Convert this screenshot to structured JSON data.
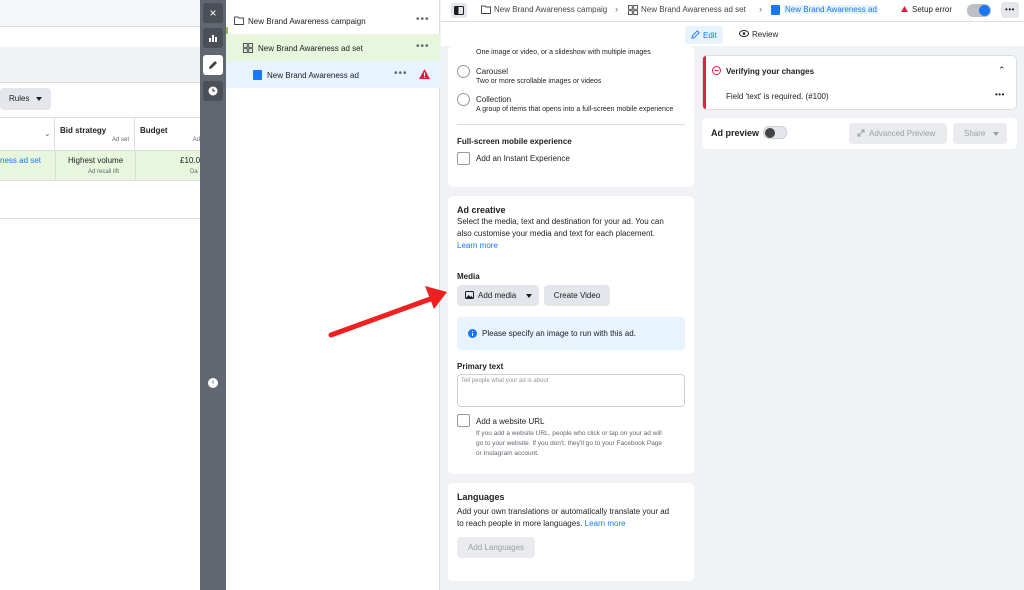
{
  "background_manager": {
    "rules_label": "Rules",
    "columns": [
      {
        "header": "",
        "sub": ""
      },
      {
        "header": "Bid strategy",
        "sub": "Ad set"
      },
      {
        "header": "Budget",
        "sub": "Ad"
      }
    ],
    "row": {
      "name": "ness ad set",
      "bid_strategy": "Highest volume",
      "bid_sub": "Ad recall lift",
      "budget": "£10.0",
      "budget_sub": "Da"
    }
  },
  "rail": {
    "close_icon": "×",
    "chart_icon": "chart-icon",
    "edit_icon": "pencil-icon",
    "history_icon": "clock-icon",
    "collapse_icon": "‹"
  },
  "tree": {
    "campaign": "New Brand Awareness campaign",
    "adset": "New Brand Awareness ad set",
    "ad": "New Brand Awareness ad",
    "more": "•••"
  },
  "topbar": {
    "crumbs": [
      "New Brand Awareness campaig",
      "New Brand Awareness ad set",
      "New Brand Awareness ad"
    ],
    "setup_error": "Setup error",
    "more": "•••"
  },
  "tabs": {
    "edit": "Edit",
    "review": "Review"
  },
  "format_card": {
    "single_sub": "One image or video, or a slideshow with multiple images",
    "carousel_title": "Carousel",
    "carousel_sub": "Two or more scrollable images or videos",
    "collection_title": "Collection",
    "collection_sub": "A group of items that opens into a full-screen mobile experience",
    "fullscreen_title": "Full-screen mobile experience",
    "instant_experience": "Add an Instant Experience"
  },
  "creative_card": {
    "title": "Ad creative",
    "desc_line1": "Select the media, text and destination for your ad. You can",
    "desc_line2": "also customise your media and text for each placement.",
    "learn_more": "Learn more",
    "media_label": "Media",
    "add_media": "Add media",
    "create_video": "Create Video",
    "info_text": "Please specify an image to run with this ad.",
    "primary_text_label": "Primary text",
    "primary_text_placeholder": "Tell people what your ad is about",
    "website_url_label": "Add a website URL",
    "website_desc_line1": "If you add a website URL, people who click or tap on your ad will",
    "website_desc_line2": "go to your website. If you don't, they'll go to your Facebook Page",
    "website_desc_line3": "or Instagram account."
  },
  "languages_card": {
    "title": "Languages",
    "desc_line1": "Add your own translations or automatically translate your ad",
    "desc_line2_pre": "to reach people in more languages.",
    "learn_more": "Learn more",
    "button": "Add Languages"
  },
  "verify_panel": {
    "title": "Verifying your changes",
    "error": "Field 'text' is required. (#100)",
    "more": "•••"
  },
  "preview_panel": {
    "label": "Ad preview",
    "advanced": "Advanced Preview",
    "share": "Share"
  },
  "colors": {
    "accent": "#1877f2",
    "error": "#e41e3f",
    "arrow": "#f02020"
  }
}
